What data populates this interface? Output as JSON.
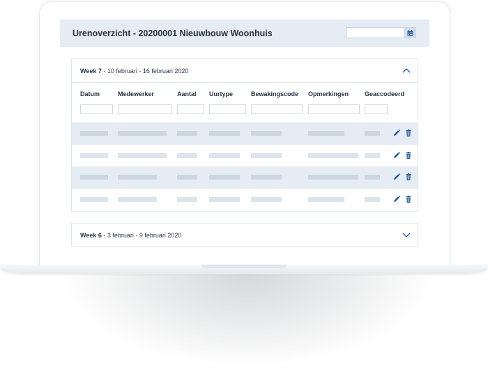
{
  "header": {
    "title": "Urenoverzicht - 20200001 Nieuwbouw Woonhuis",
    "date_value": ""
  },
  "weeks": [
    {
      "label_bold": "Week 7",
      "label_range": " - 10 februari - 16 februari 2020",
      "expanded": true
    },
    {
      "label_bold": "Week 6",
      "label_range": " - 3 februari - 9 februari 2020",
      "expanded": false
    }
  ],
  "table": {
    "columns": [
      "Datum",
      "Medewerker",
      "Aantal",
      "Uurtype",
      "Bewakingscode",
      "Opmerkingen",
      "Geaccodeerd"
    ],
    "row_count": 4
  },
  "icons": {
    "calendar": "calendar-icon",
    "edit": "pencil-icon",
    "delete": "trash-icon",
    "collapse": "chevron-up-icon",
    "expand": "chevron-down-icon"
  },
  "colors": {
    "accent": "#1f5a96",
    "header_bg": "#e6ecf3",
    "row_shade": "#e6ecf3",
    "placeholder": "#cdd7e2"
  }
}
